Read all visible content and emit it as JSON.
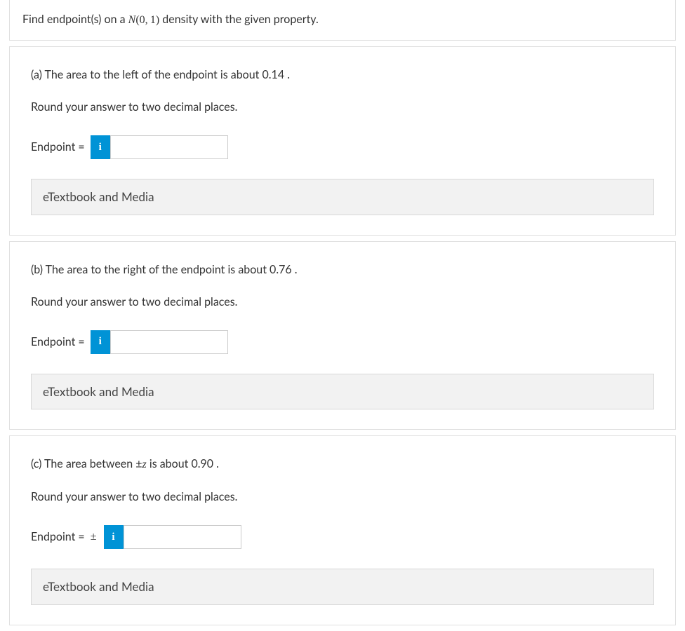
{
  "intro": {
    "prefix": "Find endpoint(s) on a ",
    "notation_n": "N",
    "notation_args": "(0, 1)",
    "suffix": " density with the given property."
  },
  "parts": {
    "a": {
      "prompt": "(a) The area to the left of the endpoint is about 0.14 .",
      "instruction": "Round your answer to two decimal places.",
      "label": "Endpoint =",
      "info_glyph": "i",
      "resource": "eTextbook and Media"
    },
    "b": {
      "prompt": "(b) The area to the right of the endpoint is about 0.76 .",
      "instruction": "Round your answer to two decimal places.",
      "label": "Endpoint =",
      "info_glyph": "i",
      "resource": "eTextbook and Media"
    },
    "c": {
      "prompt_prefix": "(c) The area between ",
      "prompt_pm": "±",
      "prompt_z": "z",
      "prompt_suffix": " is about 0.90 .",
      "instruction": "Round your answer to two decimal places.",
      "label": "Endpoint  =",
      "plusminus": "±",
      "info_glyph": "i",
      "resource": "eTextbook and Media"
    }
  }
}
